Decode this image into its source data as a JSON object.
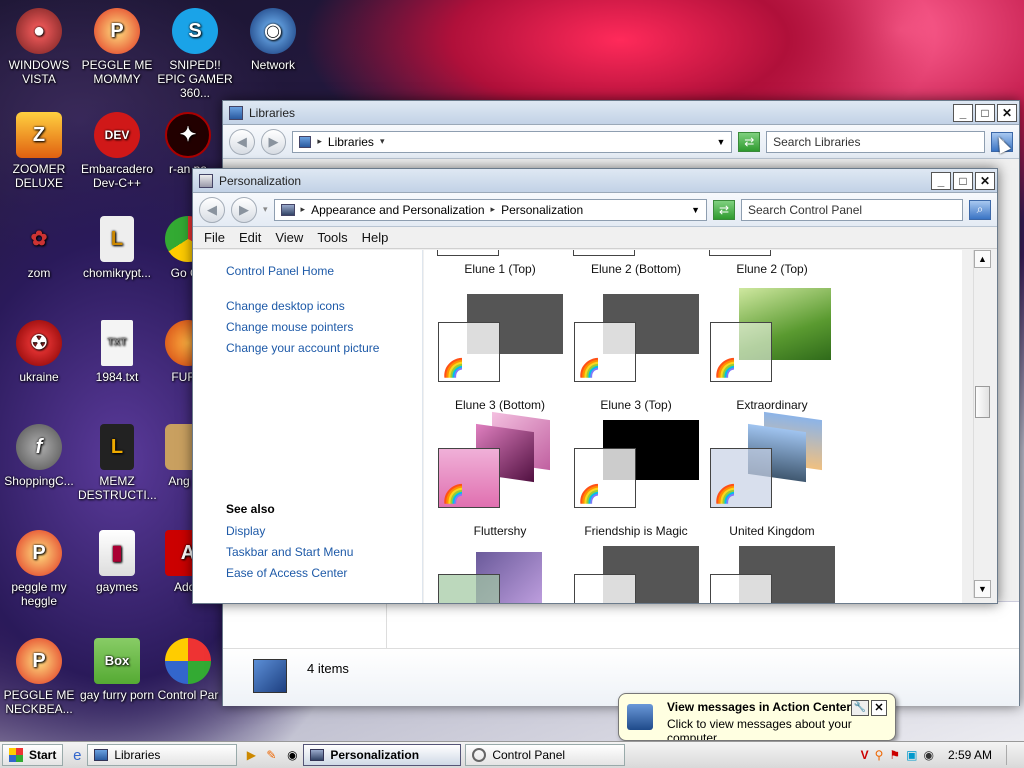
{
  "desktop": {
    "icons": [
      {
        "label": "WINDOWS VISTA",
        "icon": "vista-icon"
      },
      {
        "label": "PEGGLE ME MOMMY",
        "icon": "peggle-icon"
      },
      {
        "label": "SNIPED!! EPIC GAMER 360...",
        "icon": "skype-icon"
      },
      {
        "label": "Network",
        "icon": "network-icon"
      },
      {
        "label": "ZOOMER DELUXE",
        "icon": "zuma-icon"
      },
      {
        "label": "Embarcadero Dev-C++",
        "icon": "devcpp-icon"
      },
      {
        "label": "r-an pa",
        "icon": "app-icon"
      },
      {
        "label": "zom",
        "icon": "flower-icon"
      },
      {
        "label": "chomikrypt...",
        "icon": "file-icon"
      },
      {
        "label": "Go Ch",
        "icon": "chrome-icon"
      },
      {
        "label": "ukraine",
        "icon": "radiation-icon"
      },
      {
        "label": "1984.txt",
        "icon": "text-file-icon"
      },
      {
        "label": "FURR",
        "icon": "firefox-icon"
      },
      {
        "label": "ShoppingC...",
        "icon": "flash-icon"
      },
      {
        "label": "MEMZ DESTRUCTI...",
        "icon": "file-icon"
      },
      {
        "label": "Ang Se",
        "icon": "game-icon"
      },
      {
        "label": "peggle my heggle",
        "icon": "peggle-icon"
      },
      {
        "label": "gaymes",
        "icon": "folder-icon"
      },
      {
        "label": "Adob",
        "icon": "adobe-icon"
      },
      {
        "label": "PEGGLE ME NECKBEA...",
        "icon": "peggle-icon"
      },
      {
        "label": "gay furry porn",
        "icon": "box-icon"
      },
      {
        "label": "Control Par",
        "icon": "control-panel-icon"
      }
    ]
  },
  "libraries": {
    "title": "Libraries",
    "address": "Libraries",
    "search_placeholder": "Search Libraries",
    "status_count": "4 items"
  },
  "personalization": {
    "title": "Personalization",
    "breadcrumb": [
      "Appearance and Personalization",
      "Personalization"
    ],
    "search_placeholder": "Search Control Panel",
    "menu": [
      "File",
      "Edit",
      "View",
      "Tools",
      "Help"
    ],
    "left_links": [
      "Control Panel Home",
      "Change desktop icons",
      "Change mouse pointers",
      "Change your account picture"
    ],
    "see_also_heading": "See also",
    "see_also_links": [
      "Display",
      "Taskbar and Start Menu",
      "Ease of Access Center"
    ],
    "themes_row1": [
      "Elune 1 (Top)",
      "Elune 2 (Bottom)",
      "Elune 2 (Top)"
    ],
    "themes_row2": [
      "Elune 3 (Bottom)",
      "Elune 3 (Top)",
      "Extraordinary"
    ],
    "themes_row3": [
      "Fluttershy",
      "Friendship is Magic",
      "United Kingdom"
    ]
  },
  "notification": {
    "title": "View messages in Action Center",
    "body": "Click to view messages about your computer."
  },
  "taskbar": {
    "start_label": "Start",
    "tasks": [
      "Libraries",
      "Personalization",
      "Control Panel"
    ],
    "clock": "2:59 AM"
  },
  "colors": {
    "link": "#1e5aa8",
    "title_bg": "#c2d2e6"
  }
}
